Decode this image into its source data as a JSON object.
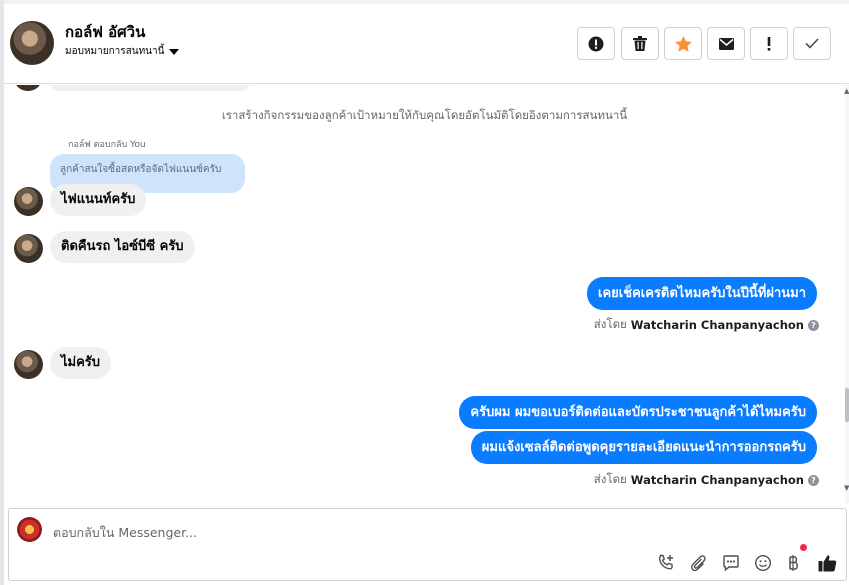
{
  "header": {
    "name": "กอล์ฟ อัศวิน",
    "assign_label": "มอบหมายการสนทนานี้",
    "actions": [
      {
        "name": "spam-button",
        "icon": "exclamation-circle-icon"
      },
      {
        "name": "delete-button",
        "icon": "trash-icon"
      },
      {
        "name": "star-button",
        "icon": "star-icon"
      },
      {
        "name": "mark-unread-button",
        "icon": "envelope-icon"
      },
      {
        "name": "follow-up-button",
        "icon": "exclamation-icon"
      },
      {
        "name": "mark-done-button",
        "icon": "check-icon"
      }
    ]
  },
  "messages": {
    "system_note": "เราสร้างกิจกรรมของลูกค้าเป้าหมายให้กับคุณโดยอัตโนมัติโดยอิงตามการสนทนานี้",
    "reply_label": "กอล์ฟ ตอบกลับ You",
    "quoted_text": "ลูกค้าสนใจซื้อสดหรือจัดไฟแนนซ์ครับ",
    "in_1": "ไฟแนนท์ครับ",
    "in_2": "ติดคืนรถ ไอซ์บีซี ครับ",
    "out_1": "เคยเช็คเครดิตไหมครับในปีนี้ที่ผ่านมา",
    "sent_by_prefix": "ส่งโดย",
    "sent_by_name": "Watcharin Chanpanyachon",
    "in_3": "ไม่ครับ",
    "out_2": "ครับผม ผมขอเบอร์ติดต่อและบัตรประชาชนลูกค้าได้ไหมครับ",
    "out_3": "ผมแจ้งเซลล์ติดต่อพูดคุยรายละเอียดแนะนำการออกรถครับ",
    "sent_by_prefix_2": "ส่งโดย",
    "sent_by_name_2": "Watcharin Chanpanyachon"
  },
  "composer": {
    "placeholder": "ตอบกลับใน Messenger...",
    "tools": [
      "phone-add-icon",
      "paperclip-icon",
      "chat-bubble-icon",
      "smiley-icon",
      "baht-icon",
      "thumbs-up-icon"
    ]
  },
  "colors": {
    "outgoing_bubble": "#0a7cff",
    "incoming_bubble": "#f0f0f0",
    "quoted_bubble": "#cfe3fb",
    "star": "#f7923b"
  }
}
